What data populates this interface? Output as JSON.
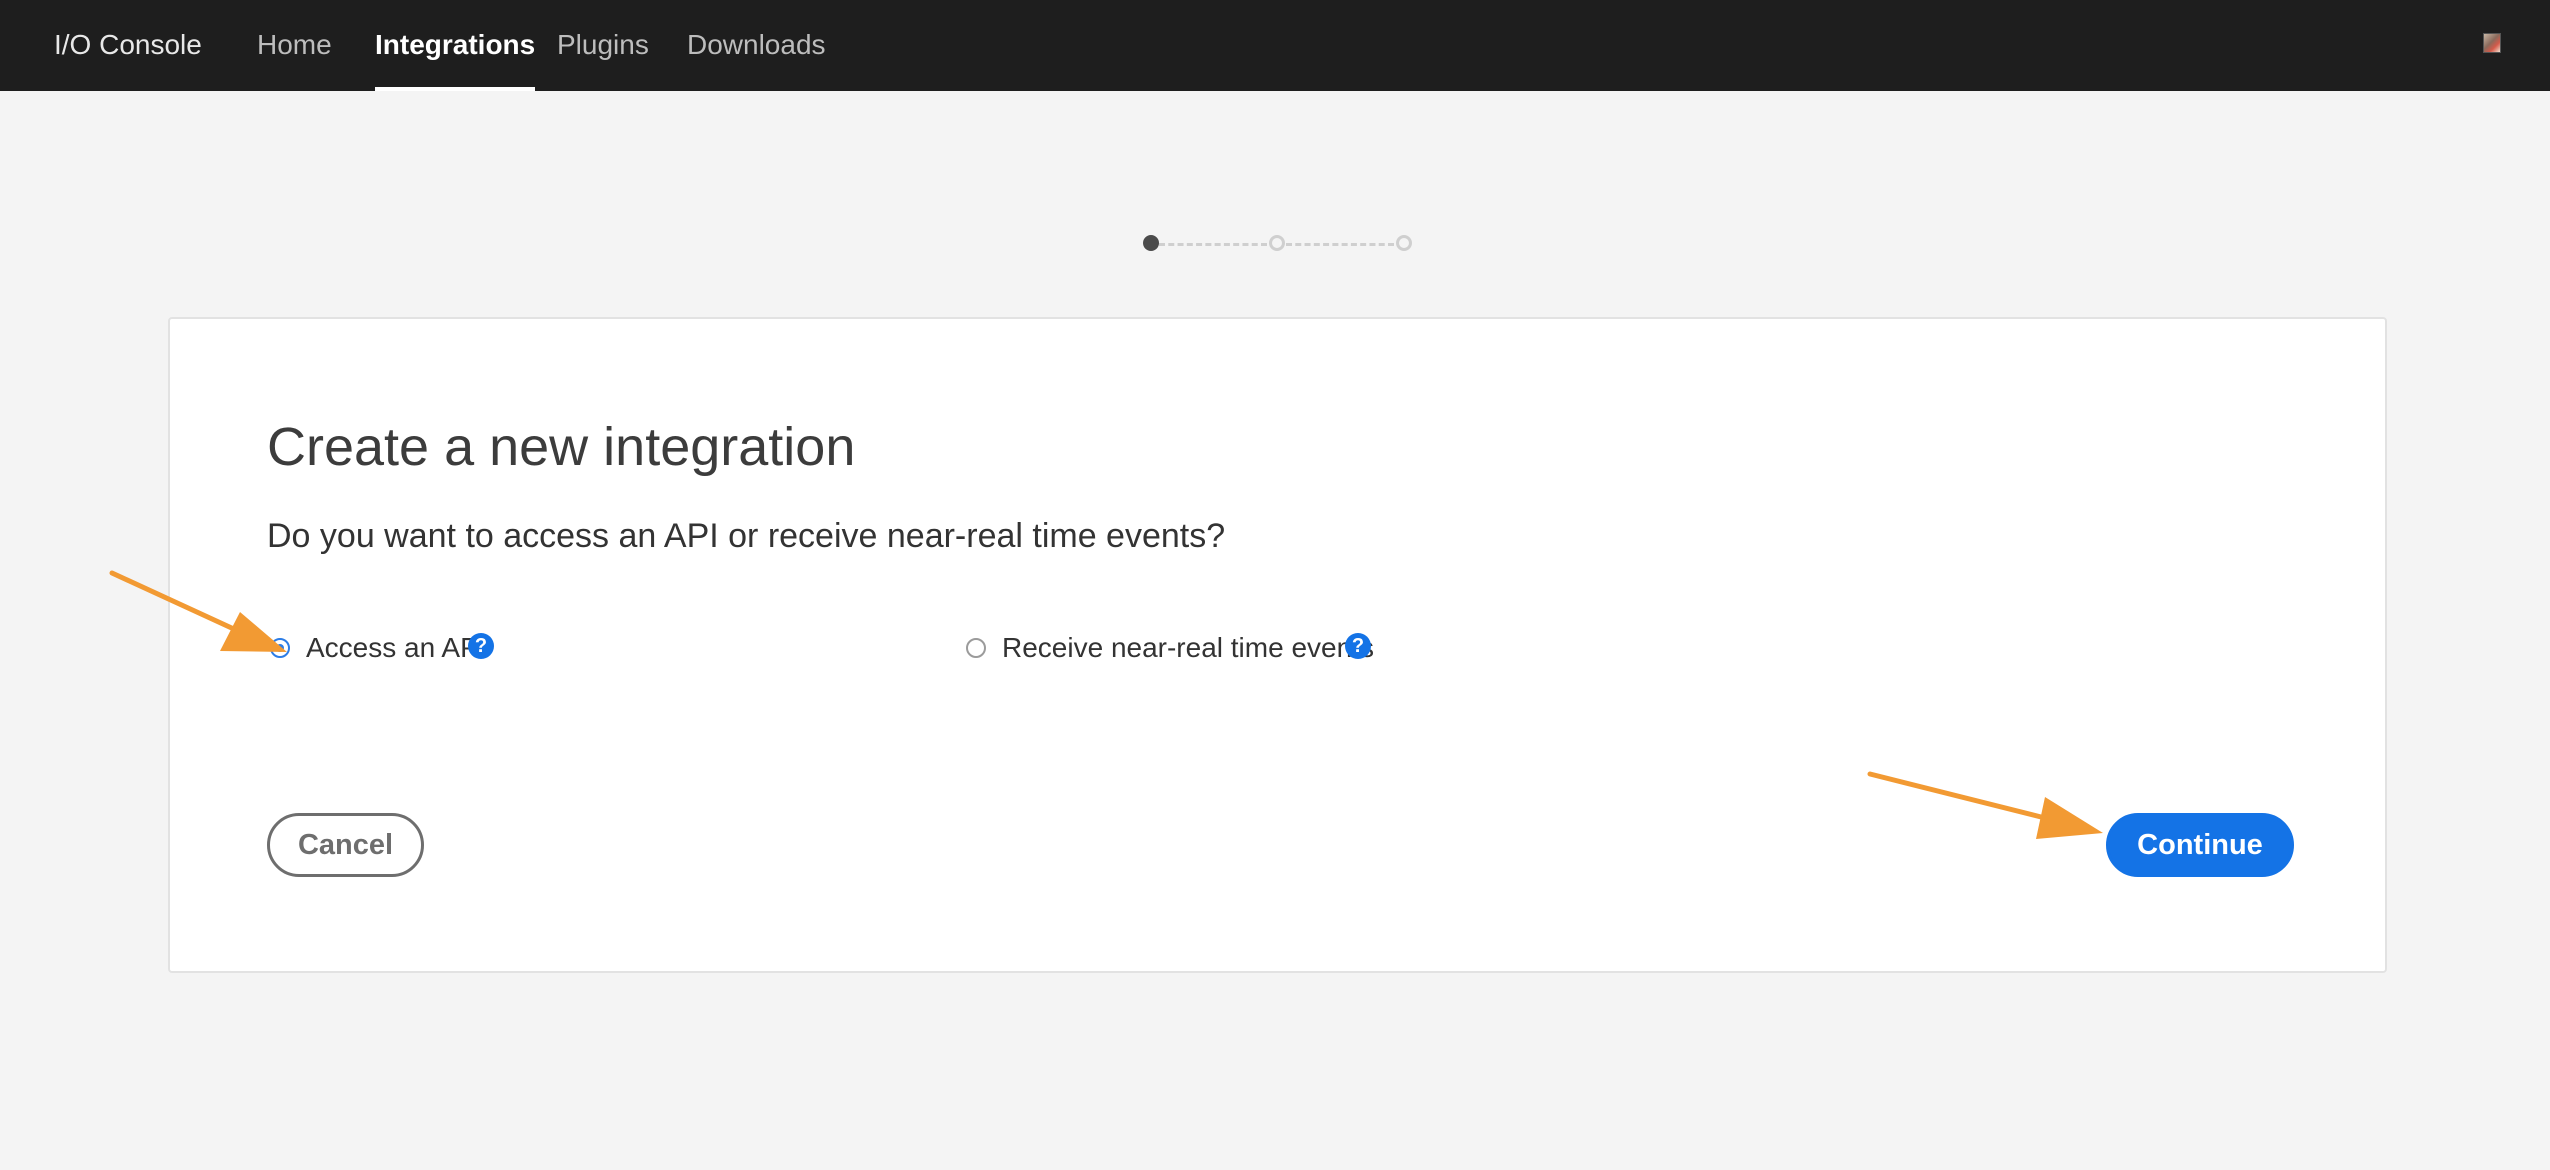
{
  "header": {
    "brand": "I/O Console",
    "nav": [
      {
        "label": "Home",
        "active": false
      },
      {
        "label": "Integrations",
        "active": true
      },
      {
        "label": "Plugins",
        "active": false
      },
      {
        "label": "Downloads",
        "active": false
      }
    ],
    "avatar_icon": "user-avatar-icon"
  },
  "stepper": {
    "total_steps": 3,
    "current_step": 1
  },
  "card": {
    "title": "Create a new integration",
    "question": "Do you want to access an API or receive near-real time events?",
    "options": [
      {
        "label": "Access an API",
        "selected": true,
        "help_icon": "?"
      },
      {
        "label": "Receive near-real time events",
        "selected": false,
        "help_icon": "?"
      }
    ],
    "cancel_label": "Cancel",
    "continue_label": "Continue"
  },
  "colors": {
    "accent": "#1473e6",
    "header_bg": "#1e1e1e",
    "page_bg": "#f4f4f4",
    "annotation_arrow": "#f29a33"
  }
}
